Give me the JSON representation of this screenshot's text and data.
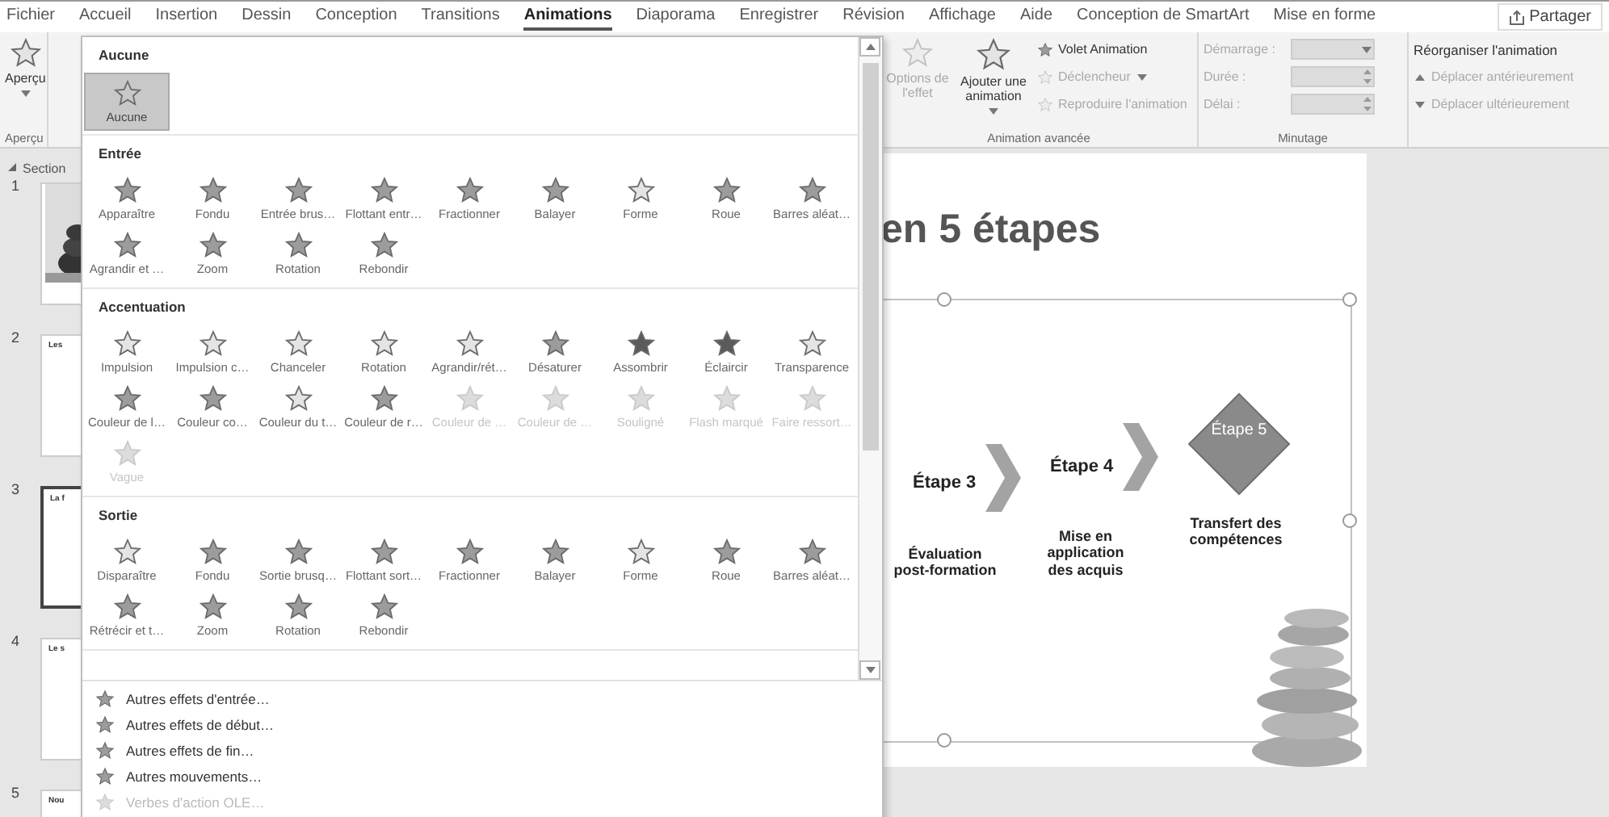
{
  "menu_tabs": [
    {
      "label": "Fichier",
      "selected": false
    },
    {
      "label": "Accueil",
      "selected": false
    },
    {
      "label": "Insertion",
      "selected": false
    },
    {
      "label": "Dessin",
      "selected": false
    },
    {
      "label": "Conception",
      "selected": false
    },
    {
      "label": "Transitions",
      "selected": false
    },
    {
      "label": "Animations",
      "selected": true
    },
    {
      "label": "Diaporama",
      "selected": false
    },
    {
      "label": "Enregistrer",
      "selected": false
    },
    {
      "label": "Révision",
      "selected": false
    },
    {
      "label": "Affichage",
      "selected": false
    },
    {
      "label": "Aide",
      "selected": false
    },
    {
      "label": "Conception de SmartArt",
      "selected": false
    },
    {
      "label": "Mise en forme",
      "selected": false
    }
  ],
  "share_button": {
    "label": "Partager"
  },
  "ribbon": {
    "preview": {
      "label": "Aperçu",
      "group": "Aperçu"
    },
    "effect_options": {
      "label": "Options de l'effet",
      "disabled": true
    },
    "add_animation": {
      "label": "Ajouter une animation"
    },
    "advanced_items": [
      {
        "label": "Volet Animation",
        "disabled": false,
        "dropdown": false
      },
      {
        "label": "Déclencheur",
        "disabled": true,
        "dropdown": true
      },
      {
        "label": "Reproduire l'animation",
        "disabled": true,
        "dropdown": false
      }
    ],
    "advanced_group": "Animation avancée",
    "timing_items": [
      {
        "label": "Démarrage :",
        "disabled": true,
        "kind": "dropdown"
      },
      {
        "label": "Durée :",
        "disabled": true,
        "kind": "spinner"
      },
      {
        "label": "Délai :",
        "disabled": true,
        "kind": "spinner"
      }
    ],
    "timing_group": "Minutage",
    "reorder": {
      "title": "Réorganiser l'animation",
      "items": [
        {
          "label": "Déplacer antérieurement",
          "disabled": true,
          "kind": "up"
        },
        {
          "label": "Déplacer ultérieurement",
          "disabled": true,
          "kind": "down"
        }
      ]
    }
  },
  "section": "Section",
  "slides": [
    {
      "number": "1",
      "selected": false,
      "kind": "picture"
    },
    {
      "number": "2",
      "title": "Les",
      "selected": false,
      "kind": "text"
    },
    {
      "number": "3",
      "title": "La f",
      "selected": true,
      "kind": "text"
    },
    {
      "number": "4",
      "title": "Le s",
      "selected": false,
      "kind": "text"
    },
    {
      "number": "5",
      "title": "Nou",
      "selected": false,
      "kind": "text"
    }
  ],
  "gallery": {
    "sections": [
      {
        "title": "Aucune",
        "items": [
          {
            "label": "Aucune",
            "selected": true,
            "disabled": false,
            "kind": "none"
          }
        ]
      },
      {
        "title": "Entrée",
        "items": [
          {
            "label": "Apparaître",
            "selected": false,
            "disabled": false,
            "kind": "star"
          },
          {
            "label": "Fondu",
            "selected": false,
            "disabled": false,
            "kind": "star"
          },
          {
            "label": "Entrée brus…",
            "selected": false,
            "disabled": false,
            "kind": "star"
          },
          {
            "label": "Flottant entr…",
            "selected": false,
            "disabled": false,
            "kind": "star"
          },
          {
            "label": "Fractionner",
            "selected": false,
            "disabled": false,
            "kind": "star"
          },
          {
            "label": "Balayer",
            "selected": false,
            "disabled": false,
            "kind": "star"
          },
          {
            "label": "Forme",
            "selected": false,
            "disabled": false,
            "kind": "outline"
          },
          {
            "label": "Roue",
            "selected": false,
            "disabled": false,
            "kind": "star"
          },
          {
            "label": "Barres aléat…",
            "selected": false,
            "disabled": false,
            "kind": "star"
          },
          {
            "label": "Agrandir et …",
            "selected": false,
            "disabled": false,
            "kind": "star"
          },
          {
            "label": "Zoom",
            "selected": false,
            "disabled": false,
            "kind": "star"
          },
          {
            "label": "Rotation",
            "selected": false,
            "disabled": false,
            "kind": "star"
          },
          {
            "label": "Rebondir",
            "selected": false,
            "disabled": false,
            "kind": "star"
          }
        ]
      },
      {
        "title": "Accentuation",
        "items": [
          {
            "label": "Impulsion",
            "selected": false,
            "disabled": false,
            "kind": "outline"
          },
          {
            "label": "Impulsion c…",
            "selected": false,
            "disabled": false,
            "kind": "outline"
          },
          {
            "label": "Chanceler",
            "selected": false,
            "disabled": false,
            "kind": "outline"
          },
          {
            "label": "Rotation",
            "selected": false,
            "disabled": false,
            "kind": "outline"
          },
          {
            "label": "Agrandir/rét…",
            "selected": false,
            "disabled": false,
            "kind": "outline"
          },
          {
            "label": "Désaturer",
            "selected": false,
            "disabled": false,
            "kind": "star"
          },
          {
            "label": "Assombrir",
            "selected": false,
            "disabled": false,
            "kind": "dark"
          },
          {
            "label": "Éclaircir",
            "selected": false,
            "disabled": false,
            "kind": "dark"
          },
          {
            "label": "Transparence",
            "selected": false,
            "disabled": false,
            "kind": "outline"
          },
          {
            "label": "Couleur de l…",
            "selected": false,
            "disabled": false,
            "kind": "star"
          },
          {
            "label": "Couleur co…",
            "selected": false,
            "disabled": false,
            "kind": "star"
          },
          {
            "label": "Couleur du t…",
            "selected": false,
            "disabled": false,
            "kind": "outline"
          },
          {
            "label": "Couleur de r…",
            "selected": false,
            "disabled": false,
            "kind": "star"
          },
          {
            "label": "Couleur de …",
            "selected": false,
            "disabled": true,
            "kind": "star"
          },
          {
            "label": "Couleur de …",
            "selected": false,
            "disabled": true,
            "kind": "star"
          },
          {
            "label": "Souligné",
            "selected": false,
            "disabled": true,
            "kind": "star"
          },
          {
            "label": "Flash marqué",
            "selected": false,
            "disabled": true,
            "kind": "star"
          },
          {
            "label": "Faire ressort…",
            "selected": false,
            "disabled": true,
            "kind": "star"
          },
          {
            "label": "Vague",
            "selected": false,
            "disabled": true,
            "kind": "star"
          }
        ]
      },
      {
        "title": "Sortie",
        "items": [
          {
            "label": "Disparaître",
            "selected": false,
            "disabled": false,
            "kind": "outline"
          },
          {
            "label": "Fondu",
            "selected": false,
            "disabled": false,
            "kind": "star"
          },
          {
            "label": "Sortie brusq…",
            "selected": false,
            "disabled": false,
            "kind": "star"
          },
          {
            "label": "Flottant sort…",
            "selected": false,
            "disabled": false,
            "kind": "star"
          },
          {
            "label": "Fractionner",
            "selected": false,
            "disabled": false,
            "kind": "star"
          },
          {
            "label": "Balayer",
            "selected": false,
            "disabled": false,
            "kind": "star"
          },
          {
            "label": "Forme",
            "selected": false,
            "disabled": false,
            "kind": "outline"
          },
          {
            "label": "Roue",
            "selected": false,
            "disabled": false,
            "kind": "star"
          },
          {
            "label": "Barres aléat…",
            "selected": false,
            "disabled": false,
            "kind": "star"
          },
          {
            "label": "Rétrécir et t…",
            "selected": false,
            "disabled": false,
            "kind": "star"
          },
          {
            "label": "Zoom",
            "selected": false,
            "disabled": false,
            "kind": "star"
          },
          {
            "label": "Rotation",
            "selected": false,
            "disabled": false,
            "kind": "star"
          },
          {
            "label": "Rebondir",
            "selected": false,
            "disabled": false,
            "kind": "star"
          }
        ]
      }
    ],
    "commands": [
      {
        "label": "Autres effets d'entrée…",
        "disabled": false
      },
      {
        "label": "Autres effets de début…",
        "disabled": false
      },
      {
        "label": "Autres effets de fin…",
        "disabled": false
      },
      {
        "label": "Autres mouvements…",
        "disabled": false
      },
      {
        "label": "Verbes d'action OLE…",
        "disabled": true
      }
    ]
  },
  "slide": {
    "title": "en 5 étapes",
    "steps": [
      {
        "label": "Étape 3",
        "caption": "Évaluation post-formation",
        "kind": "chevron"
      },
      {
        "label": "Étape 4",
        "caption": "Mise en application des acquis",
        "kind": "chevron"
      },
      {
        "label": "Étape 5",
        "caption": "Transfert des compétences",
        "kind": "diamond"
      }
    ]
  }
}
